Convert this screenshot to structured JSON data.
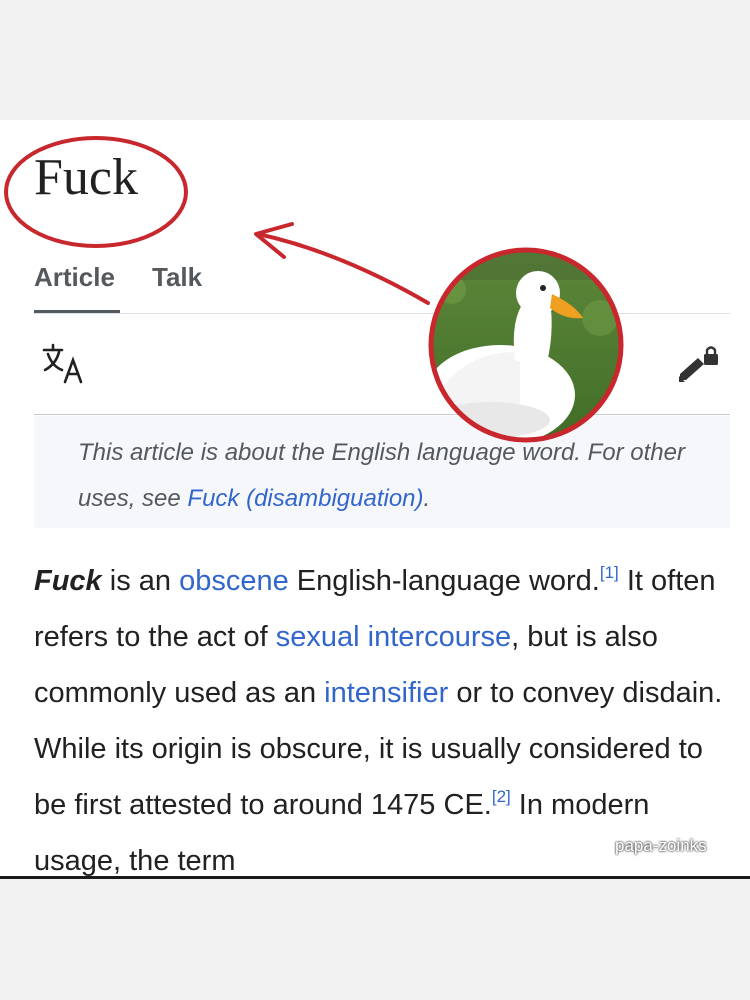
{
  "article": {
    "title": "Fuck",
    "tabs": [
      {
        "label": "Article",
        "active": true
      },
      {
        "label": "Talk",
        "active": false
      }
    ]
  },
  "toolbar": {
    "language_icon": "translate-icon",
    "edit_icon": "edit-lock-icon"
  },
  "hatnote": {
    "text_before": "This article is about the English language word. For other uses, see ",
    "link_text": "Fuck (disambiguation)",
    "text_after": "."
  },
  "lead": {
    "term": "Fuck",
    "t1": " is an ",
    "link_obscene": "obscene",
    "t2": " English-language word.",
    "ref1": "[1]",
    "t3": " It often refers to the act of ",
    "link_sex": "sexual intercourse",
    "t4": ", but is also commonly used as an ",
    "link_intensifier": "intensifier",
    "t5": " or to convey disdain. While its origin is obscure, it is usually considered to be first attested to around 1475 CE.",
    "ref2": "[2]",
    "t6": " In modern usage, the term"
  },
  "annotation": {
    "circle_color": "#c8272d",
    "arrow_color": "#c8272d",
    "image": "white-duck-photo"
  },
  "watermark": "papa-zoinks"
}
